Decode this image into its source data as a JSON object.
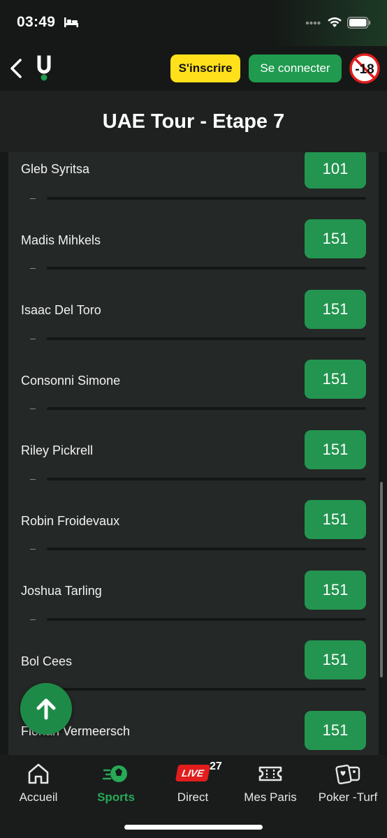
{
  "status_bar": {
    "time": "03:49",
    "icons": [
      "bed-icon",
      "signal-icon",
      "wifi-icon",
      "battery-icon"
    ]
  },
  "header": {
    "back_icon": "chevron-left-icon",
    "logo": "unibet-logo-icon",
    "register_label": "S'inscrire",
    "login_label": "Se connecter",
    "age_badge": "-18"
  },
  "title": "UAE Tour - Etape 7",
  "runners": [
    {
      "name": "Gleb Syritsa",
      "odds": "101",
      "sub": "–"
    },
    {
      "name": "Madis Mihkels",
      "odds": "151",
      "sub": "–"
    },
    {
      "name": "Isaac Del Toro",
      "odds": "151",
      "sub": "–"
    },
    {
      "name": "Consonni Simone",
      "odds": "151",
      "sub": "–"
    },
    {
      "name": "Riley Pickrell",
      "odds": "151",
      "sub": "–"
    },
    {
      "name": "Robin Froidevaux",
      "odds": "151",
      "sub": "–"
    },
    {
      "name": "Joshua Tarling",
      "odds": "151",
      "sub": "–"
    },
    {
      "name": "Bol Cees",
      "odds": "151",
      "sub": ""
    },
    {
      "name": "Florian Vermeersch",
      "odds": "151",
      "sub": ""
    }
  ],
  "scroll_top_icon": "arrow-up-icon",
  "tabbar": {
    "tabs": [
      {
        "label": "Accueil",
        "icon": "home-icon",
        "active": false
      },
      {
        "label": "Sports",
        "icon": "sports-icon",
        "active": true
      },
      {
        "label": "Direct",
        "icon": "live-icon",
        "active": false
      },
      {
        "label": "Mes Paris",
        "icon": "ticket-icon",
        "active": false
      },
      {
        "label": "Poker -Turf",
        "icon": "cards-icon",
        "active": false
      }
    ],
    "live_badge": "LIVE",
    "live_count": "27"
  },
  "colors": {
    "accent_green": "#239550",
    "register_yellow": "#ffe01b",
    "live_red": "#e11d1d",
    "background": "#161918"
  }
}
